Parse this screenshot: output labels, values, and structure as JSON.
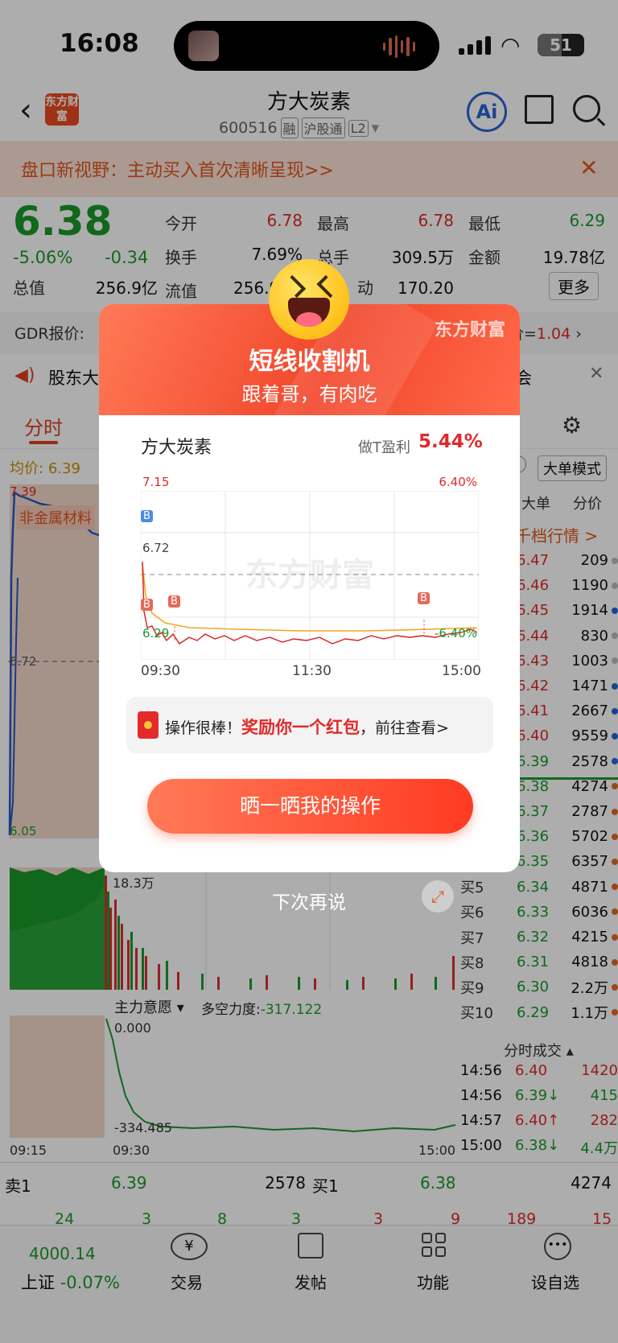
{
  "status": {
    "time": "16:08",
    "battery": "51"
  },
  "header": {
    "stock_name": "方大炭素",
    "stock_code": "600516",
    "tags": [
      "融",
      "沪股通",
      "L2"
    ],
    "logo_text": "东方财富",
    "ai_label": "Ai"
  },
  "banner": {
    "text": "盘口新视野：主动买入首次清晰呈现>>"
  },
  "quote": {
    "price": "6.38",
    "change_pct": "-5.06%",
    "change": "-0.34",
    "total_cap_label": "总值",
    "total_cap": "256.9亿",
    "fields": [
      {
        "label": "今开",
        "value": "6.78"
      },
      {
        "label": "最高",
        "value": "6.78"
      },
      {
        "label": "最低",
        "value": "6.29"
      },
      {
        "label": "换手",
        "value": "7.69%"
      },
      {
        "label": "总手",
        "value": "309.5万"
      },
      {
        "label": "金额",
        "value": "19.78亿"
      },
      {
        "label": "流值",
        "value": "256.9"
      },
      {
        "label": "动",
        "value": "170.20"
      }
    ],
    "more": "更多"
  },
  "gdr": {
    "label": "GDR报价:",
    "right_label": "价=",
    "right_value": "1.04"
  },
  "notice": {
    "text": "股东大",
    "right": "会"
  },
  "tabs": {
    "active": "分时"
  },
  "chart_bar": {
    "avg_label": "均价:",
    "avg_value": "6.39",
    "mode": "大单模式"
  },
  "main_chart": {
    "high": "7.39",
    "low": "6.05",
    "mid": "6.72",
    "sector": "非金属材料"
  },
  "volume": {
    "max": "18.3万"
  },
  "indicator": {
    "name": "主力意愿",
    "force_label": "多空力度:",
    "force_value": "-317.122",
    "top": "0.000",
    "bottom": "-334.485",
    "x_start": "09:15",
    "x_mid": "09:30",
    "x_end": "15:00"
  },
  "orderbook": {
    "header": [
      "大单",
      "分价"
    ],
    "link": "千档行情 >",
    "rows": [
      {
        "label": "",
        "price": "6.47",
        "vol": "209",
        "dot": "#bbbbbb"
      },
      {
        "label": "",
        "price": "6.46",
        "vol": "1190",
        "dot": "#bbbbbb"
      },
      {
        "label": "",
        "price": "6.45",
        "vol": "1914",
        "dot": "#2864d8"
      },
      {
        "label": "",
        "price": "6.44",
        "vol": "830",
        "dot": "#bbbbbb"
      },
      {
        "label": "",
        "price": "6.43",
        "vol": "1003",
        "dot": "#bbbbbb"
      },
      {
        "label": "",
        "price": "6.42",
        "vol": "1471",
        "dot": "#2864d8"
      },
      {
        "label": "",
        "price": "6.41",
        "vol": "2667",
        "dot": "#2864d8"
      },
      {
        "label": "",
        "price": "6.40",
        "vol": "9559",
        "dot": "#2864d8"
      },
      {
        "label": "",
        "price": "6.39",
        "vol": "2578",
        "dot": "#2864d8"
      },
      {
        "label": "",
        "price": "6.38",
        "vol": "4274",
        "dot": "#e06a20"
      },
      {
        "label": "",
        "price": "6.37",
        "vol": "2787",
        "dot": "#e06a20"
      },
      {
        "label": "",
        "price": "6.36",
        "vol": "5702",
        "dot": "#e06a20"
      },
      {
        "label": "买4",
        "price": "6.35",
        "vol": "6357",
        "dot": "#e06a20"
      },
      {
        "label": "买5",
        "price": "6.34",
        "vol": "4871",
        "dot": "#e06a20"
      },
      {
        "label": "买6",
        "price": "6.33",
        "vol": "6036",
        "dot": "#e06a20"
      },
      {
        "label": "买7",
        "price": "6.32",
        "vol": "4215",
        "dot": "#e06a20"
      },
      {
        "label": "买8",
        "price": "6.31",
        "vol": "4818",
        "dot": "#e06a20"
      },
      {
        "label": "买9",
        "price": "6.30",
        "vol": "2.2万",
        "dot": "#e06a20"
      },
      {
        "label": "买10",
        "price": "6.29",
        "vol": "1.1万",
        "dot": "#e06a20"
      }
    ]
  },
  "ticks": {
    "title": "分时成交",
    "rows": [
      {
        "time": "14:56",
        "price": "6.40",
        "vol": "1420",
        "arrow": ""
      },
      {
        "time": "14:56",
        "price": "6.39↓",
        "vol": "415",
        "arrow": ""
      },
      {
        "time": "14:57",
        "price": "6.40↑",
        "vol": "282",
        "arrow": ""
      },
      {
        "time": "15:00",
        "price": "6.38↓",
        "vol": "4.4万",
        "arrow": ""
      }
    ]
  },
  "bottom_quote": {
    "sell_label": "卖1",
    "sell_price": "6.39",
    "sell_vol": "2578",
    "buy_label": "买1",
    "buy_price": "6.38",
    "buy_vol": "4274",
    "left_nums": [
      "24",
      "3",
      "8",
      "3"
    ],
    "right_nums": [
      "3",
      "9",
      "189",
      "15"
    ]
  },
  "tabbar": {
    "index_value": "4000.14",
    "index_name": "上证",
    "index_change": "-0.07%",
    "items": [
      {
        "label": "交易",
        "icon": "yuan-exchange-icon"
      },
      {
        "label": "发帖",
        "icon": "compose-icon"
      },
      {
        "label": "功能",
        "icon": "grid-icon"
      },
      {
        "label": "设自选",
        "icon": "more-dots-icon"
      }
    ]
  },
  "modal": {
    "brand": "东方财富",
    "title": "短线收割机",
    "subtitle": "跟着哥，有肉吃",
    "stock": "方大炭素",
    "profit_label": "做T盈利",
    "profit_value": "5.44%",
    "chart": {
      "y_top_left": "7.15",
      "y_top_right": "6.40%",
      "y_mid": "6.72",
      "y_bottom_left": "6.29",
      "y_bottom_right": "-6.40%",
      "x_ticks": [
        "09:30",
        "11:30",
        "15:00"
      ],
      "watermark": "东方财富",
      "marker": "B"
    },
    "reward_prefix": "操作很棒！",
    "reward_highlight": "奖励你一个红包",
    "reward_suffix": "，前往查看>",
    "button": "晒一晒我的操作",
    "later": "下次再说"
  }
}
